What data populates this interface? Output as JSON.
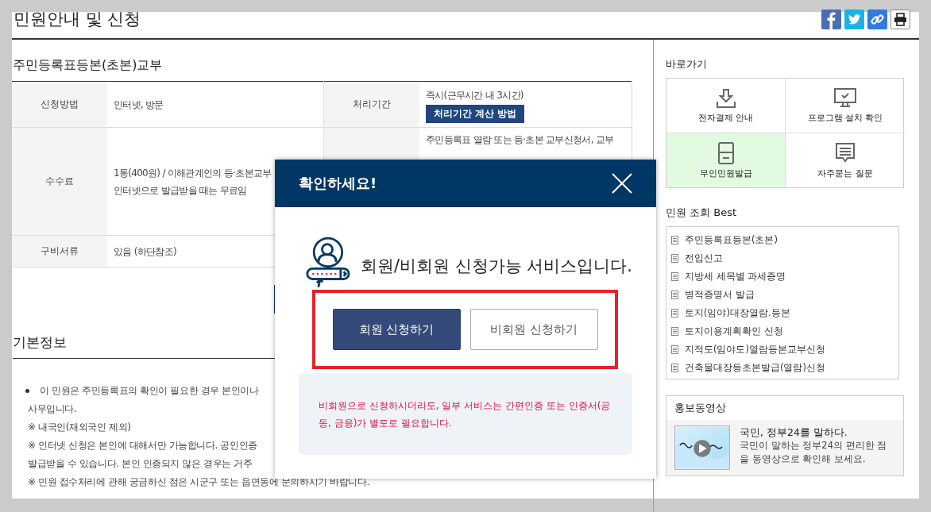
{
  "page_title": "민원안내 및 신청",
  "section_title": "주민등록표등본(초본)교부",
  "info_table": {
    "rows": [
      {
        "label": "신청방법",
        "value_lines": [
          "인터넷, 방문"
        ],
        "label_2": "처리기간",
        "value_2_lines": [
          "즉시(근무시간 내 3시간)"
        ],
        "button": "처리기간 계산 방법"
      },
      {
        "label": "수수료",
        "value_lines": [
          "1통(400원) / 이해관계인의 등·초본교부",
          "인터넷으로 발급받을 때는 무료임"
        ],
        "value_2_lines": [
          "주민등록표 열람 또는 등·초본 교부신청서, 교부"
        ]
      },
      {
        "label": "구비서류",
        "value_lines": [
          "있음 (하단참조)"
        ]
      }
    ]
  },
  "basic_info": {
    "title": "기본정보",
    "lines": [
      {
        "kind": "bullet",
        "text": "이 민원은 주민등록표의 확인이 필요한 경우 본인이나"
      },
      {
        "kind": "plain",
        "text": "사무입니다."
      },
      {
        "kind": "plain",
        "text": "※ 내국인(재외국인 제외)"
      },
      {
        "kind": "plain",
        "text": "※ 인터넷 신청은 본인에 대해서만 가능합니다. 공인인증"
      },
      {
        "kind": "plain",
        "text": "발급받을 수 있습니다. 본인 인증되지 않은 경우는 거주"
      },
      {
        "kind": "plain",
        "text": "※ 민원 접수처리에 관해 궁금하신 점은 시군구 또는 읍면동에 문의하시기 바랍니다."
      }
    ]
  },
  "sidebar": {
    "shortcuts_title": "바로가기",
    "shortcuts": [
      {
        "label": "전자결제 안내",
        "selected": false
      },
      {
        "label": "프로그램 설치 확인",
        "selected": false
      },
      {
        "label": "무인민원발급",
        "selected": true
      },
      {
        "label": "자주묻는 질문",
        "selected": false
      }
    ],
    "best_title": "민원 조회 Best",
    "best_items": [
      "주민등록표등본(초본)",
      "전입신고",
      "지방세 세목별 과세증명",
      "병적증명서 발급",
      "토지(임야)대장열람.등본",
      "토지이용계획확인 신청",
      "지적도(임야도)열람등본교부신청",
      "건축물대장등초본발급(열람)신청"
    ],
    "video": {
      "title": "홍보동영상",
      "headline": "국민, 정부24를 말하다.",
      "description": "국민이 말하는 정부24의 편리한 점을 동영상으로 확인해 보세요."
    }
  },
  "modal": {
    "title": "확인하세요!",
    "message": "회원/비회원 신청가능 서비스입니다.",
    "buttons": [
      {
        "label": "회원 신청하기",
        "kind": "primary"
      },
      {
        "label": "비회원 신청하기",
        "kind": "secondary"
      }
    ],
    "notice": "비회원으로 신청하시더라도, 일부 서비스는 간편인증 또는 인증서(공동, 금융)가 별도로 필요합니다."
  }
}
